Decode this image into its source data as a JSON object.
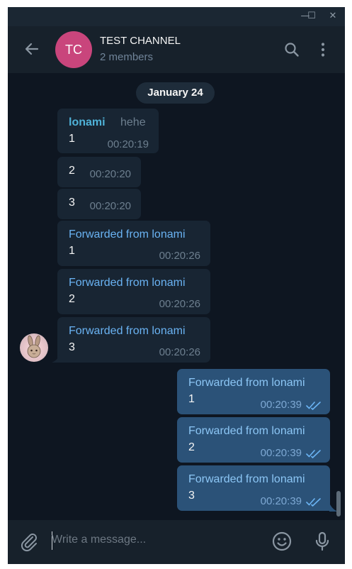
{
  "window": {
    "minimize": "—",
    "maximize": "☐",
    "close": "✕"
  },
  "chat": {
    "avatar_initials": "TC",
    "title": "TEST CHANNEL",
    "subtitle": "2 members",
    "avatar_color": "#c9457c"
  },
  "date_badge": "January 24",
  "messages_in": [
    {
      "sender": "lonami",
      "extra": "hehe",
      "text": "1",
      "time": "00:20:19"
    },
    {
      "text": "2",
      "time": "00:20:20"
    },
    {
      "text": "3",
      "time": "00:20:20"
    },
    {
      "forwarded": "Forwarded from lonami",
      "text": "1",
      "time": "00:20:26"
    },
    {
      "forwarded": "Forwarded from lonami",
      "text": "2",
      "time": "00:20:26"
    },
    {
      "forwarded": "Forwarded from lonami",
      "text": "3",
      "time": "00:20:26"
    }
  ],
  "messages_out": [
    {
      "forwarded": "Forwarded from lonami",
      "text": "1",
      "time": "00:20:39"
    },
    {
      "forwarded": "Forwarded from lonami",
      "text": "2",
      "time": "00:20:39"
    },
    {
      "forwarded": "Forwarded from lonami",
      "text": "3",
      "time": "00:20:39"
    }
  ],
  "composer": {
    "placeholder": "Write a message..."
  },
  "icons": [
    "back-arrow-icon",
    "search-icon",
    "more-vertical-icon",
    "attach-icon",
    "emoji-icon",
    "microphone-icon",
    "double-check-icon"
  ],
  "colors": {
    "background": "#0e1621",
    "header": "#17212b",
    "incoming": "#182533",
    "outgoing": "#2b5278",
    "accent": "#6ab3f3"
  }
}
